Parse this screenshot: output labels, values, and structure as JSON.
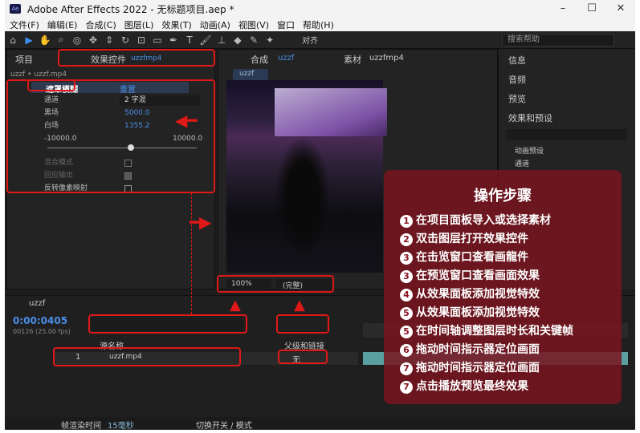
{
  "window": {
    "title": "Adobe After Effects 2022 - 无标题项目.aep *",
    "app_badge": "Ae",
    "minimize": "–",
    "maximize": "☐",
    "close": "✕"
  },
  "menu": [
    "文件(F)",
    "编辑(E)",
    "合成(C)",
    "图层(L)",
    "效果(T)",
    "动画(A)",
    "视图(V)",
    "窗口",
    "帮助(H)"
  ],
  "toolbar": {
    "search_placeholder": "搜索帮助",
    "align_label": "对齐"
  },
  "project_panel": {
    "tab_project": "项目",
    "tab_effects": "效果控件",
    "effects_file": "uzzfmp4",
    "layer_path": "uzzf • uzzf.mp4"
  },
  "effect": {
    "name": "遮罩模糊",
    "reset": "重置",
    "rows": [
      {
        "label": "通道",
        "value": "2 字混"
      },
      {
        "label": "黑场",
        "value": "5000.0"
      },
      {
        "label": "白场",
        "value": "1355.2"
      },
      {
        "label": "-10000.0",
        "value": "10000.0"
      },
      {
        "label": "混合模式",
        "value": ""
      },
      {
        "label": "回应输出",
        "value": ""
      },
      {
        "label": "反转像素映射",
        "value": ""
      }
    ]
  },
  "comp_panel": {
    "tab_comp": "合成",
    "comp_name": "uzzf",
    "tab_footage": "素材",
    "footage_name": "uzzfmp4",
    "comp_chip": "uzzf",
    "zoom": "100%",
    "quality": "(完整)"
  },
  "right_panel": {
    "items": [
      "信息",
      "音频",
      "预览",
      "效果和预设"
    ],
    "tree": [
      "动画预设",
      "通道"
    ]
  },
  "overlay": {
    "heading": "操作步骤",
    "steps": [
      {
        "num": "1",
        "text": "在项目面板导入或选择素材"
      },
      {
        "num": "2",
        "text": "双击图层打开效果控件"
      },
      {
        "num": "3",
        "text": "在击览窗口查看画龍件"
      },
      {
        "num": "3",
        "text": "在预览窗口查看画面效果"
      },
      {
        "num": "4",
        "text": "从效果面板添加视觉特效"
      },
      {
        "num": "5",
        "text": "从效果面板添加视觉特效"
      },
      {
        "num": "5",
        "text": "在时间轴调整图层时长和关键帧"
      },
      {
        "num": "6",
        "text": "拖动时间指示器定位画面"
      },
      {
        "num": "7",
        "text": "拖动时间指示器定位画面"
      },
      {
        "num": "7",
        "text": "点击播放预览最终效果"
      }
    ]
  },
  "timeline": {
    "tab": "uzzf",
    "timecode": "0:00:0405",
    "fps": "00126 (25.00 fps)",
    "col_source": "源名称",
    "col_parent": "父级和链接",
    "layer_num": "1",
    "layer_name": "uzzf.mp4",
    "parent_value": "无"
  },
  "status": {
    "render_label": "帧渲染时间",
    "render_value": "15毫秒",
    "toggle": "切换开关 / 模式"
  },
  "colors": {
    "accent": "#3b8ff0",
    "highlight": "#e01818",
    "overlay": "#78141e"
  }
}
